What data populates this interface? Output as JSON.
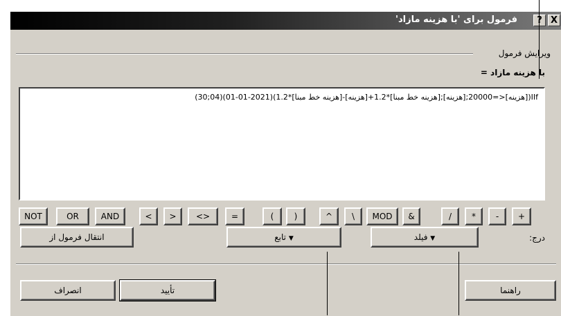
{
  "window": {
    "title": "فرمول برای 'با هزینه مازاد'",
    "help_label": "?",
    "close_label": "X"
  },
  "section_title": "ویرایش فرمول",
  "formula_field_label": "با هزینه مازاد =",
  "formula_text": "IIf([هزینه]<=20000;[هزینه];[هزینه خط مبنا]*1.2+[هزینه]-[هزینه خط مبنا]*1.2)(2021-01-01)(04;30)",
  "operators": {
    "not": "NOT",
    "or": "OR",
    "and": "AND",
    "lt": "<",
    "gt": ">",
    "ne": "<>",
    "eq": "=",
    "lparen": "(",
    "rparen": ")",
    "caret": "^",
    "backslash": "\\",
    "mod": "MOD",
    "amp": "&",
    "slash": "/",
    "star": "*",
    "minus": "-",
    "plus": "+"
  },
  "insert_label": "درج:",
  "field_dropdown": {
    "label": "فیلد",
    "arrow": "▼"
  },
  "function_dropdown": {
    "label": "تابع",
    "arrow": "▼"
  },
  "import_button": "انتقال فرمول از",
  "buttons": {
    "ok": "تأیید",
    "cancel": "انصراف",
    "help": "راهنما"
  },
  "colors": {
    "face": "#d4d0c8",
    "title_start": "#000000",
    "title_end": "#7a7a7a"
  }
}
